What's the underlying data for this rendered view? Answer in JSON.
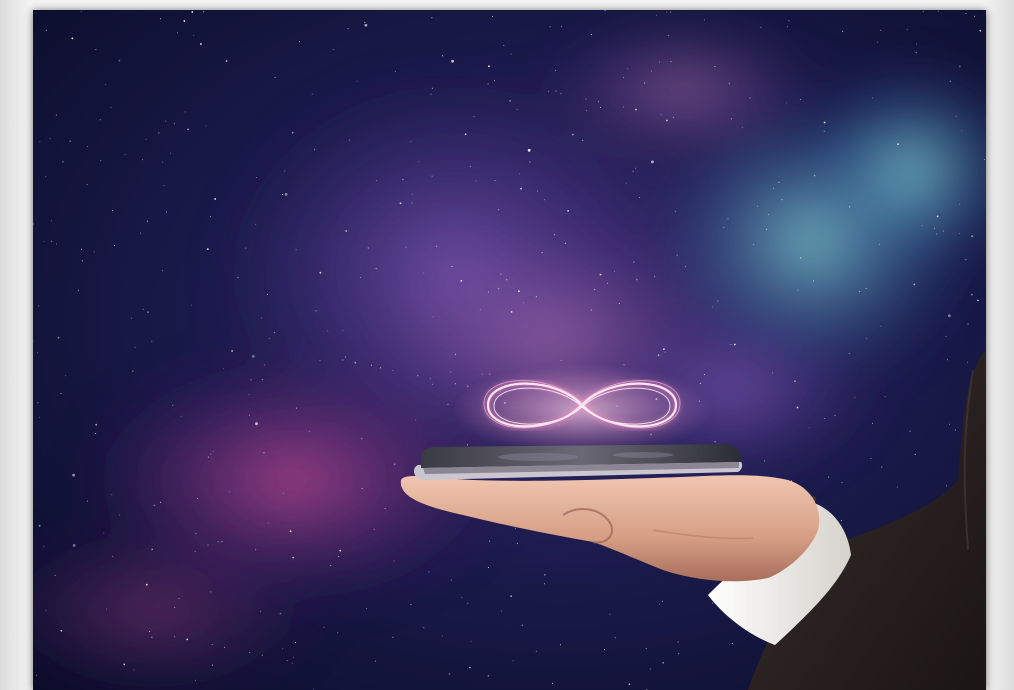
{
  "image": {
    "subject": "hand-holding-phone-with-infinity-hologram",
    "colors": {
      "space_deep": "#0a0d2a",
      "nebula_purple": "#5b2f7e",
      "nebula_magenta": "#b13f86",
      "nebula_cyan": "#7fd4d8",
      "infinity_glow": "#ffe0ef",
      "suit": "#2b2222",
      "cuff": "#f1efea",
      "skin": "#d9a68c"
    },
    "icons": [
      "infinity-icon",
      "smartphone-icon",
      "hand-icon"
    ]
  }
}
